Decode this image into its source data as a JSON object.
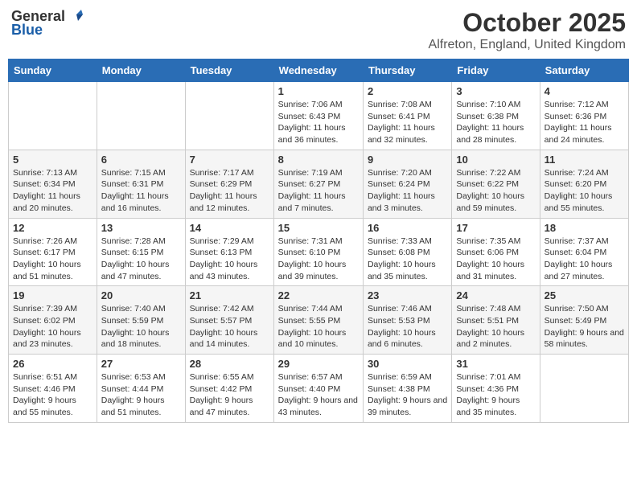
{
  "header": {
    "logo_general": "General",
    "logo_blue": "Blue",
    "month": "October 2025",
    "location": "Alfreton, England, United Kingdom"
  },
  "weekdays": [
    "Sunday",
    "Monday",
    "Tuesday",
    "Wednesday",
    "Thursday",
    "Friday",
    "Saturday"
  ],
  "weeks": [
    [
      {
        "day": "",
        "info": ""
      },
      {
        "day": "",
        "info": ""
      },
      {
        "day": "",
        "info": ""
      },
      {
        "day": "1",
        "info": "Sunrise: 7:06 AM\nSunset: 6:43 PM\nDaylight: 11 hours and 36 minutes."
      },
      {
        "day": "2",
        "info": "Sunrise: 7:08 AM\nSunset: 6:41 PM\nDaylight: 11 hours and 32 minutes."
      },
      {
        "day": "3",
        "info": "Sunrise: 7:10 AM\nSunset: 6:38 PM\nDaylight: 11 hours and 28 minutes."
      },
      {
        "day": "4",
        "info": "Sunrise: 7:12 AM\nSunset: 6:36 PM\nDaylight: 11 hours and 24 minutes."
      }
    ],
    [
      {
        "day": "5",
        "info": "Sunrise: 7:13 AM\nSunset: 6:34 PM\nDaylight: 11 hours and 20 minutes."
      },
      {
        "day": "6",
        "info": "Sunrise: 7:15 AM\nSunset: 6:31 PM\nDaylight: 11 hours and 16 minutes."
      },
      {
        "day": "7",
        "info": "Sunrise: 7:17 AM\nSunset: 6:29 PM\nDaylight: 11 hours and 12 minutes."
      },
      {
        "day": "8",
        "info": "Sunrise: 7:19 AM\nSunset: 6:27 PM\nDaylight: 11 hours and 7 minutes."
      },
      {
        "day": "9",
        "info": "Sunrise: 7:20 AM\nSunset: 6:24 PM\nDaylight: 11 hours and 3 minutes."
      },
      {
        "day": "10",
        "info": "Sunrise: 7:22 AM\nSunset: 6:22 PM\nDaylight: 10 hours and 59 minutes."
      },
      {
        "day": "11",
        "info": "Sunrise: 7:24 AM\nSunset: 6:20 PM\nDaylight: 10 hours and 55 minutes."
      }
    ],
    [
      {
        "day": "12",
        "info": "Sunrise: 7:26 AM\nSunset: 6:17 PM\nDaylight: 10 hours and 51 minutes."
      },
      {
        "day": "13",
        "info": "Sunrise: 7:28 AM\nSunset: 6:15 PM\nDaylight: 10 hours and 47 minutes."
      },
      {
        "day": "14",
        "info": "Sunrise: 7:29 AM\nSunset: 6:13 PM\nDaylight: 10 hours and 43 minutes."
      },
      {
        "day": "15",
        "info": "Sunrise: 7:31 AM\nSunset: 6:10 PM\nDaylight: 10 hours and 39 minutes."
      },
      {
        "day": "16",
        "info": "Sunrise: 7:33 AM\nSunset: 6:08 PM\nDaylight: 10 hours and 35 minutes."
      },
      {
        "day": "17",
        "info": "Sunrise: 7:35 AM\nSunset: 6:06 PM\nDaylight: 10 hours and 31 minutes."
      },
      {
        "day": "18",
        "info": "Sunrise: 7:37 AM\nSunset: 6:04 PM\nDaylight: 10 hours and 27 minutes."
      }
    ],
    [
      {
        "day": "19",
        "info": "Sunrise: 7:39 AM\nSunset: 6:02 PM\nDaylight: 10 hours and 23 minutes."
      },
      {
        "day": "20",
        "info": "Sunrise: 7:40 AM\nSunset: 5:59 PM\nDaylight: 10 hours and 18 minutes."
      },
      {
        "day": "21",
        "info": "Sunrise: 7:42 AM\nSunset: 5:57 PM\nDaylight: 10 hours and 14 minutes."
      },
      {
        "day": "22",
        "info": "Sunrise: 7:44 AM\nSunset: 5:55 PM\nDaylight: 10 hours and 10 minutes."
      },
      {
        "day": "23",
        "info": "Sunrise: 7:46 AM\nSunset: 5:53 PM\nDaylight: 10 hours and 6 minutes."
      },
      {
        "day": "24",
        "info": "Sunrise: 7:48 AM\nSunset: 5:51 PM\nDaylight: 10 hours and 2 minutes."
      },
      {
        "day": "25",
        "info": "Sunrise: 7:50 AM\nSunset: 5:49 PM\nDaylight: 9 hours and 58 minutes."
      }
    ],
    [
      {
        "day": "26",
        "info": "Sunrise: 6:51 AM\nSunset: 4:46 PM\nDaylight: 9 hours and 55 minutes."
      },
      {
        "day": "27",
        "info": "Sunrise: 6:53 AM\nSunset: 4:44 PM\nDaylight: 9 hours and 51 minutes."
      },
      {
        "day": "28",
        "info": "Sunrise: 6:55 AM\nSunset: 4:42 PM\nDaylight: 9 hours and 47 minutes."
      },
      {
        "day": "29",
        "info": "Sunrise: 6:57 AM\nSunset: 4:40 PM\nDaylight: 9 hours and 43 minutes."
      },
      {
        "day": "30",
        "info": "Sunrise: 6:59 AM\nSunset: 4:38 PM\nDaylight: 9 hours and 39 minutes."
      },
      {
        "day": "31",
        "info": "Sunrise: 7:01 AM\nSunset: 4:36 PM\nDaylight: 9 hours and 35 minutes."
      },
      {
        "day": "",
        "info": ""
      }
    ]
  ]
}
